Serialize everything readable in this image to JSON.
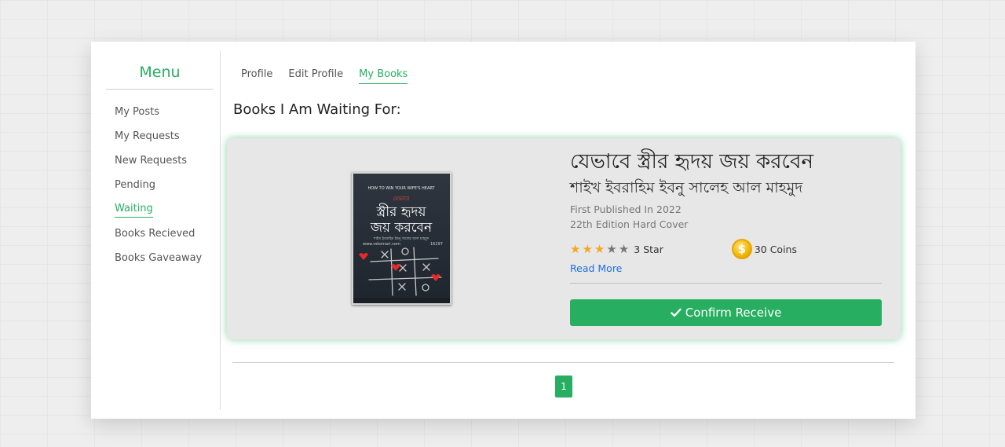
{
  "sidebar": {
    "title": "Menu",
    "items": [
      {
        "label": "My Posts"
      },
      {
        "label": "My Requests"
      },
      {
        "label": "New Requests"
      },
      {
        "label": "Pending"
      },
      {
        "label": "Waiting"
      },
      {
        "label": "Books Recieved"
      },
      {
        "label": "Books Gaveaway"
      }
    ],
    "active": "Waiting"
  },
  "tabs": [
    {
      "label": "Profile"
    },
    {
      "label": "Edit Profile"
    },
    {
      "label": "My Books"
    }
  ],
  "active_tab": "My Books",
  "heading": "Books I Am Waiting For:",
  "book": {
    "title": "যেভাবে স্ত্রীর হৃদয় জয় করবেন",
    "author": "শাইখ ইবরাহিম ইবনু সালেহ আল মাহমুদ",
    "published": "First Published In 2022",
    "edition": "22th Edition Hard Cover",
    "rating": 3,
    "rating_max": 5,
    "rating_label": "3 Star",
    "coins_label": "30 Coins",
    "read_more": "Read More",
    "confirm_label": "Confirm Receive",
    "cover": {
      "top_text": "HOW TO WIN YOUR WIFE'S HEART",
      "small_title": "যেভাবে",
      "line1": "স্ত্রীর হৃদয়",
      "line2": "জয় করবেন",
      "author_line": "শাইখ ইবরাহিম ইবনু সালেহ আল মাহমুদ",
      "website": "www.rokomari.com",
      "code": "16297"
    }
  },
  "pagination": {
    "current": "1"
  },
  "colors": {
    "accent": "#27ae60",
    "link": "#1e6fd9",
    "star_filled": "#f5a623",
    "star_empty": "#777777",
    "coin": "#f2b705"
  },
  "icons": {
    "check": "check-icon",
    "star": "star-icon",
    "coin": "coin-icon"
  }
}
